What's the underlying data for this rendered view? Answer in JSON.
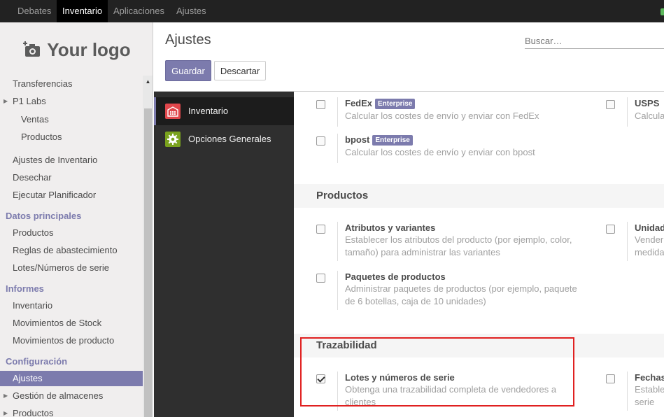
{
  "topbar": {
    "menus": [
      {
        "label": "Debates"
      },
      {
        "label": "Inventario"
      },
      {
        "label": "Aplicaciones"
      },
      {
        "label": "Ajustes"
      }
    ],
    "status_color": "#5cb85c"
  },
  "sidebar": {
    "logo_text": "Your logo",
    "logo_icon": "camera-plus-icon",
    "items": [
      {
        "label": "Transferencias"
      },
      {
        "label": "P1 Labs"
      },
      {
        "label": "Ventas"
      },
      {
        "label": "Productos"
      },
      {
        "label": "Ajustes de Inventario"
      },
      {
        "label": "Desechar"
      },
      {
        "label": "Ejecutar Planificador"
      },
      {
        "label": "Datos principales"
      },
      {
        "label": "Productos"
      },
      {
        "label": "Reglas de abastecimiento"
      },
      {
        "label": "Lotes/Números de serie"
      },
      {
        "label": "Informes"
      },
      {
        "label": "Inventario"
      },
      {
        "label": "Movimientos de Stock"
      },
      {
        "label": "Movimientos de producto"
      },
      {
        "label": "Configuración"
      },
      {
        "label": "Ajustes"
      },
      {
        "label": "Gestión de almacenes"
      },
      {
        "label": "Productos"
      }
    ]
  },
  "control_panel": {
    "title": "Ajustes",
    "search_placeholder": "Buscar…",
    "save_label": "Guardar",
    "discard_label": "Descartar"
  },
  "settings_nav": {
    "items": [
      {
        "label": "Inventario",
        "icon": "warehouse-icon",
        "color": "#e0474c"
      },
      {
        "label": "Opciones Generales",
        "icon": "gear-icon",
        "color": "#7aa21d"
      }
    ]
  },
  "content": {
    "options": [
      {
        "title": "FedEx",
        "badge": "Enterprise",
        "desc": "Calcular los costes de envío y enviar con FedEx"
      },
      {
        "title": "USPS",
        "desc": "Calcula"
      },
      {
        "title": "bpost",
        "badge": "Enterprise",
        "desc": "Calcular los costes de envío y enviar con bpost"
      },
      {
        "title": "Atributos y variantes",
        "desc": "Establecer los atributos del producto (por ejemplo, color, tamaño) para administrar las variantes"
      },
      {
        "title": "Unidad",
        "desc": "Vender medida"
      },
      {
        "title": "Paquetes de productos",
        "desc": "Administrar paquetes de productos (por ejemplo, paquete de 6 botellas, caja de 10 unidades)"
      },
      {
        "title": "Lotes y números de serie",
        "checked": true,
        "desc": "Obtenga una trazabilidad completa de vendedores a clientes"
      },
      {
        "title": "Fechas",
        "desc": "Estable serie"
      }
    ],
    "sections": [
      {
        "title": "Productos"
      },
      {
        "title": "Trazabilidad"
      }
    ],
    "highlight_color": "#e02020"
  }
}
